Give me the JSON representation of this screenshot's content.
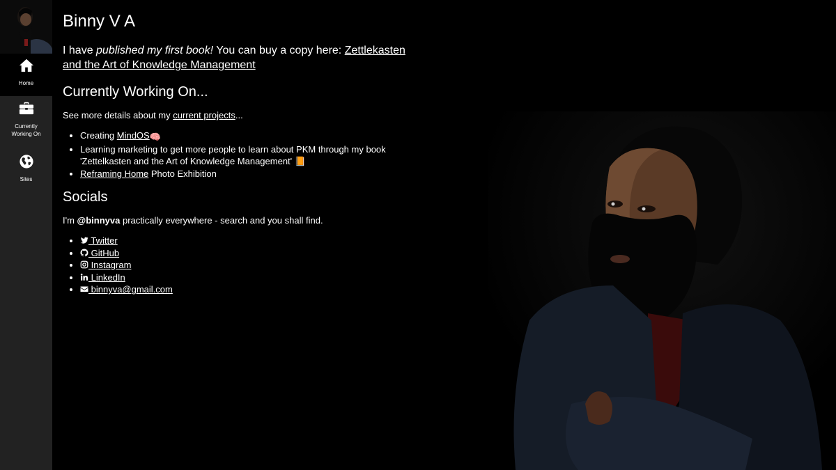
{
  "sidebar": {
    "avatar_icon": "person-photo-icon",
    "items": [
      {
        "label": "Home",
        "icon": "home-icon"
      },
      {
        "label": "Currently Working On",
        "icon": "briefcase-icon"
      },
      {
        "label": "Sites",
        "icon": "globe-icon"
      }
    ]
  },
  "main": {
    "title": "Binny V A",
    "intro": {
      "prefix": "I have ",
      "emphasis": "published my first book!",
      "middle": " You can buy a copy here: ",
      "book_link": "Zettlekasten and the Art of Knowledge Management"
    },
    "working": {
      "heading": "Currently Working On...",
      "details_prefix": "See more details about my ",
      "details_link": "current projects",
      "details_suffix": "...",
      "items": [
        {
          "prefix": "Creating ",
          "link": "MindOS",
          "suffix": " 🧠"
        },
        {
          "prefix": "Learning marketing to get more people to learn about PKM through my book 'Zettelkasten and the Art of Knowledge Management' 📙",
          "link": "",
          "suffix": ""
        },
        {
          "prefix": "",
          "link": "Reframing Home",
          "suffix": " Photo Exhibition"
        }
      ]
    },
    "socials": {
      "heading": "Socials",
      "intro_prefix": "I'm ",
      "handle": "@binnyva",
      "intro_suffix": " practically everywhere - search and you shall find.",
      "links": [
        {
          "label": " Twitter",
          "icon": "twitter-icon"
        },
        {
          "label": " GitHub",
          "icon": "github-icon"
        },
        {
          "label": " Instagram",
          "icon": "instagram-icon"
        },
        {
          "label": " LinkedIn",
          "icon": "linkedin-icon"
        },
        {
          "label": " binnyva@gmail.com",
          "icon": "envelope-icon"
        }
      ]
    }
  },
  "colors": {
    "background": "#000000",
    "sidebar": "#222222",
    "text": "#ffffff"
  }
}
